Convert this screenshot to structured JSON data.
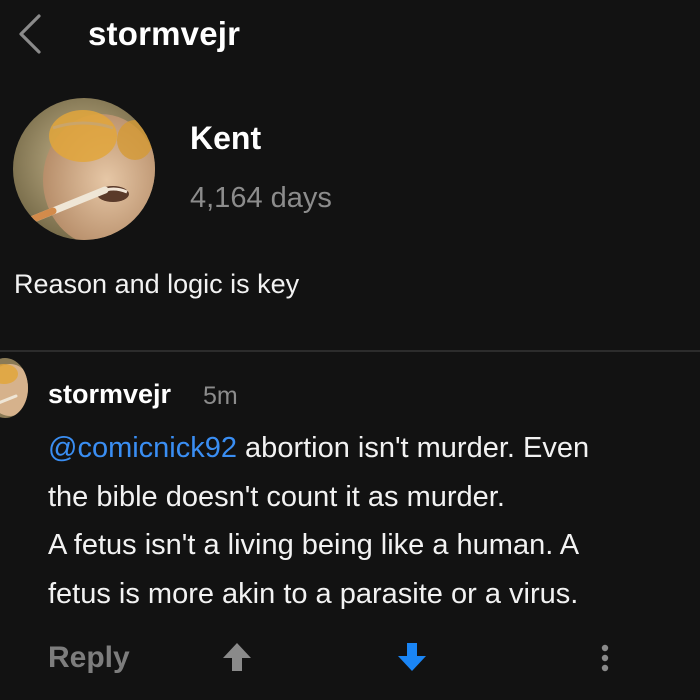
{
  "header": {
    "title": "stormvejr",
    "back_icon": "chevron-left-icon"
  },
  "profile": {
    "name": "Kent",
    "days": "4,164 days",
    "bio": "Reason and logic is key"
  },
  "comment": {
    "author": "stormvejr",
    "time": "5m",
    "mention": "@comicnick92",
    "lines": [
      " abortion isn't murder. Even",
      "the bible doesn't count it as murder.",
      "A fetus isn't a living being like a human. A",
      "fetus is more akin to a parasite or a virus."
    ]
  },
  "actions": {
    "reply_label": "Reply",
    "upvote_icon": "arrow-up-icon",
    "downvote_icon": "arrow-down-icon",
    "more_icon": "more-vertical-icon",
    "downvote_active_color": "#1a85f5",
    "inactive_color": "#8a8a8a"
  },
  "colors": {
    "background": "#121212",
    "text": "#ffffff",
    "muted": "#8c8c8c",
    "link": "#3a8ef3",
    "divider": "#2c2c2c"
  }
}
